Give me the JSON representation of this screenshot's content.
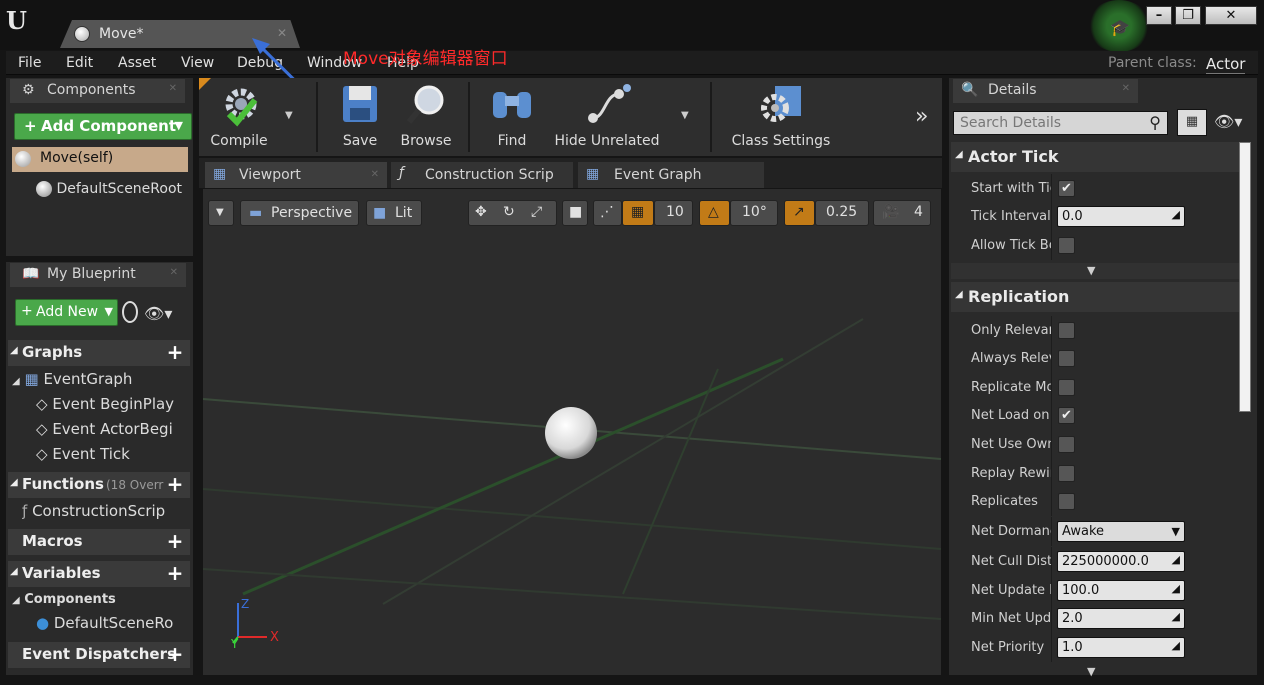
{
  "window": {
    "tab_title": "Move*",
    "annotation": "Move对象编辑器窗口",
    "parent_class_label": "Parent class:",
    "parent_class_value": "Actor",
    "min_symbol": "–",
    "max_symbol": "❐",
    "close_symbol": "✕"
  },
  "menu": [
    "File",
    "Edit",
    "Asset",
    "View",
    "Debug",
    "Window",
    "Help"
  ],
  "components_panel": {
    "title": "Components",
    "add_label": "Add Component",
    "self_label": "Move(self)",
    "root_label": "DefaultSceneRoot"
  },
  "blueprint_panel": {
    "title": "My Blueprint",
    "add_label": "Add New",
    "graphs_label": "Graphs",
    "event_graph": "EventGraph",
    "events": [
      "Event BeginPlay",
      "Event ActorBegi",
      "Event Tick"
    ],
    "functions_label": "Functions",
    "functions_note": "(18 Overr",
    "construction_script": "ConstructionScrip",
    "macros_label": "Macros",
    "variables_label": "Variables",
    "components_label": "Components",
    "default_scene_root": "DefaultSceneRo",
    "dispatchers_label": "Event Dispatchers"
  },
  "toolbar": {
    "compile": "Compile",
    "save": "Save",
    "browse": "Browse",
    "find": "Find",
    "hide_unrelated": "Hide Unrelated",
    "class_settings": "Class Settings"
  },
  "editor_tabs": [
    "Viewport",
    "Construction Scrip",
    "Event Graph"
  ],
  "viewport": {
    "perspective": "Perspective",
    "lit": "Lit",
    "grid_snap": "10",
    "rot_snap": "10°",
    "scale_snap": "0.25",
    "cam_speed": "4",
    "axis_x": "X",
    "axis_y": "Y",
    "axis_z": "Z"
  },
  "details": {
    "title": "Details",
    "search_placeholder": "Search Details",
    "actor_tick": {
      "title": "Actor Tick",
      "start_with_tick": "Start with Tick",
      "tick_interval": "Tick Interval (",
      "tick_interval_value": "0.0",
      "allow_tick": "Allow Tick Bef"
    },
    "replication": {
      "title": "Replication",
      "only_relevant": "Only Relevant",
      "always_relevant": "Always Releva",
      "replicate_movement": "Replicate Mov",
      "net_load": "Net Load on C",
      "net_use_owner": "Net Use Owne",
      "replay_rewind": "Replay Rewind",
      "replicates": "Replicates",
      "net_dormancy": "Net Dormancy",
      "net_dormancy_value": "Awake",
      "net_cull": "Net Cull Distar",
      "net_cull_value": "225000000.0",
      "net_update": "Net Update Fr",
      "net_update_value": "100.0",
      "min_net_update": "Min Net Updat",
      "min_net_update_value": "2.0",
      "net_priority": "Net Priority",
      "net_priority_value": "1.0"
    }
  }
}
